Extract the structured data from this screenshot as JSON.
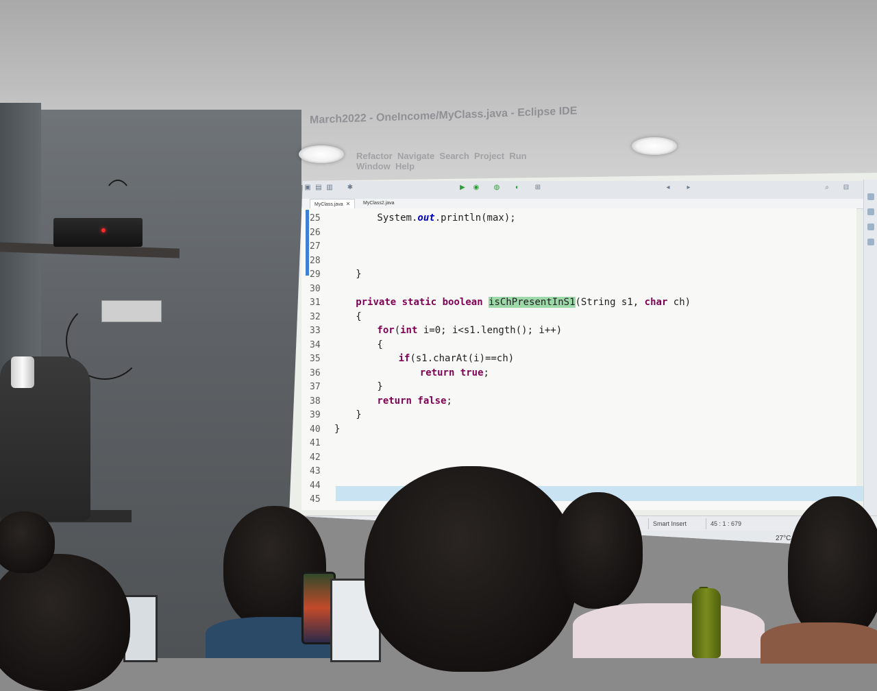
{
  "scene": {
    "ceiling_color": "#c4c4c4",
    "wall_color": "#5e6266",
    "projector_led_color": "#ff2a2a"
  },
  "window_title": "March2022 - OneIncome/MyClass.java - Eclipse IDE",
  "menu": [
    "Refactor",
    "Navigate",
    "Search",
    "Project",
    "Run",
    "Window",
    "Help"
  ],
  "tabs": [
    {
      "label": "MyClass.java",
      "active": true
    },
    {
      "label": "MyClass2.java",
      "active": false
    }
  ],
  "code_lines": [
    {
      "num": "25",
      "indent": 8,
      "parts": [
        {
          "t": "System.",
          "c": ""
        },
        {
          "t": "out",
          "c": "fld"
        },
        {
          "t": ".println(max);",
          "c": ""
        }
      ]
    },
    {
      "num": "26",
      "indent": 0,
      "parts": []
    },
    {
      "num": "27",
      "indent": 0,
      "parts": []
    },
    {
      "num": "28",
      "indent": 0,
      "parts": []
    },
    {
      "num": "29",
      "indent": 4,
      "parts": [
        {
          "t": "}",
          "c": ""
        }
      ]
    },
    {
      "num": "30",
      "indent": 0,
      "parts": []
    },
    {
      "num": "31",
      "indent": 4,
      "parts": [
        {
          "t": "private static boolean ",
          "c": "kw"
        },
        {
          "t": "isChPresentInS1",
          "c": "hl"
        },
        {
          "t": "(String s1, ",
          "c": ""
        },
        {
          "t": "char",
          "c": "kw"
        },
        {
          "t": " ch)",
          "c": ""
        }
      ]
    },
    {
      "num": "32",
      "indent": 4,
      "parts": [
        {
          "t": "{",
          "c": ""
        }
      ]
    },
    {
      "num": "33",
      "indent": 8,
      "parts": [
        {
          "t": "for",
          "c": "kw"
        },
        {
          "t": "(",
          "c": ""
        },
        {
          "t": "int",
          "c": "kw"
        },
        {
          "t": " i=0; i<s1.length(); i++)",
          "c": ""
        }
      ]
    },
    {
      "num": "34",
      "indent": 8,
      "parts": [
        {
          "t": "{",
          "c": ""
        }
      ]
    },
    {
      "num": "35",
      "indent": 12,
      "parts": [
        {
          "t": "if",
          "c": "kw"
        },
        {
          "t": "(s1.charAt(i)==ch)",
          "c": ""
        }
      ]
    },
    {
      "num": "36",
      "indent": 16,
      "parts": [
        {
          "t": "return true",
          "c": "kw"
        },
        {
          "t": ";",
          "c": ""
        }
      ]
    },
    {
      "num": "37",
      "indent": 8,
      "parts": [
        {
          "t": "}",
          "c": ""
        }
      ]
    },
    {
      "num": "38",
      "indent": 8,
      "parts": [
        {
          "t": "return false",
          "c": "kw"
        },
        {
          "t": ";",
          "c": ""
        }
      ]
    },
    {
      "num": "39",
      "indent": 4,
      "parts": [
        {
          "t": "}",
          "c": ""
        }
      ]
    },
    {
      "num": "40",
      "indent": 0,
      "parts": [
        {
          "t": "}",
          "c": ""
        }
      ]
    },
    {
      "num": "41",
      "indent": 0,
      "parts": []
    },
    {
      "num": "42",
      "indent": 0,
      "parts": []
    },
    {
      "num": "43",
      "indent": 0,
      "parts": []
    },
    {
      "num": "44",
      "indent": 0,
      "parts": []
    },
    {
      "num": "45",
      "indent": 0,
      "parts": []
    }
  ],
  "status": {
    "insert_mode": "Smart Insert",
    "position": "45 : 1 : 679"
  },
  "tray": {
    "weather": "27°C  Rain"
  },
  "colors": {
    "keyword": "#7f0055",
    "field": "#0000c0",
    "highlight": "#9dd9a8",
    "gutter_marker": "#3f7fd6"
  }
}
